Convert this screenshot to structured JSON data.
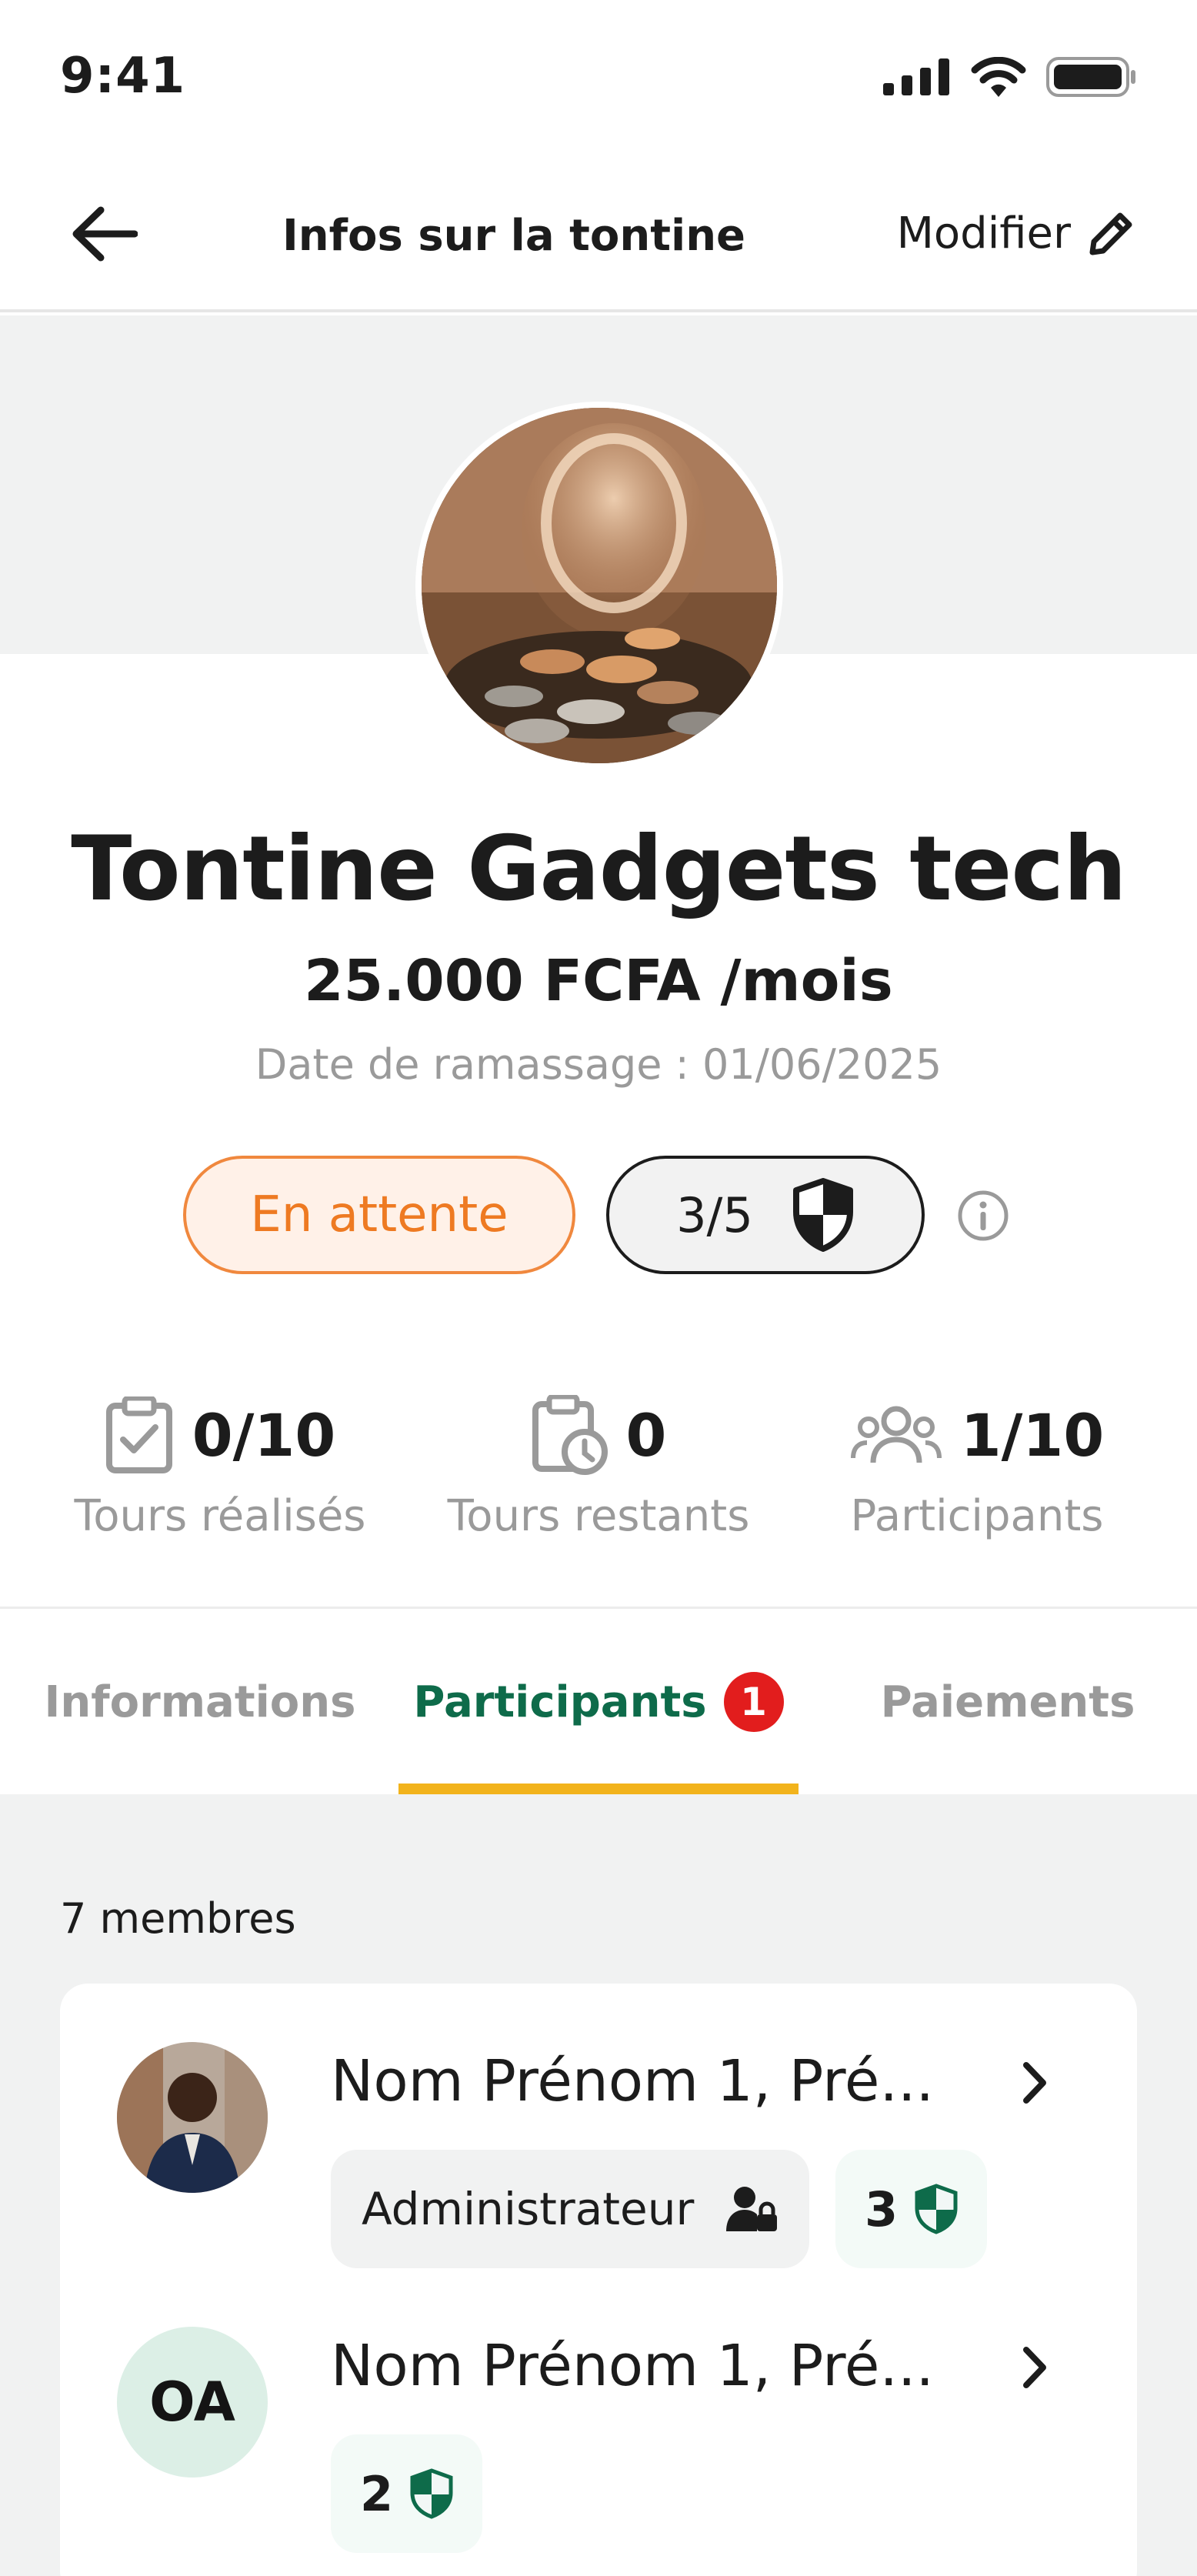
{
  "status_bar": {
    "time": "9:41"
  },
  "nav": {
    "title": "Infos sur la tontine",
    "edit_label": "Modifier"
  },
  "tontine": {
    "name": "Tontine Gadgets tech",
    "amount": "25.000 FCFA /mois",
    "pickup_date": "Date de ramassage : 01/06/2025",
    "status": "En attente",
    "trust_level": "3/5",
    "status_color": "#ee7a22"
  },
  "stats": [
    {
      "value": "0/10",
      "label": "Tours réalisés",
      "icon": "clipboard-check-icon"
    },
    {
      "value": "0",
      "label": "Tours restants",
      "icon": "clipboard-clock-icon"
    },
    {
      "value": "1/10",
      "label": "Participants",
      "icon": "group-icon"
    }
  ],
  "tabs": {
    "informations": "Informations",
    "participants": "Participants",
    "participants_badge": "1",
    "paiements": "Paiements",
    "active_color": "#0e6b4a",
    "underline_color": "#f2b31c"
  },
  "members": {
    "count_label": "7 membres",
    "items": [
      {
        "name": "Nom Prénom 1, Pré...",
        "role": "Administrateur",
        "score": "3",
        "avatar": "photo"
      },
      {
        "name": "Nom Prénom 1, Pré...",
        "role": "",
        "score": "2",
        "avatar": "OA"
      }
    ]
  }
}
